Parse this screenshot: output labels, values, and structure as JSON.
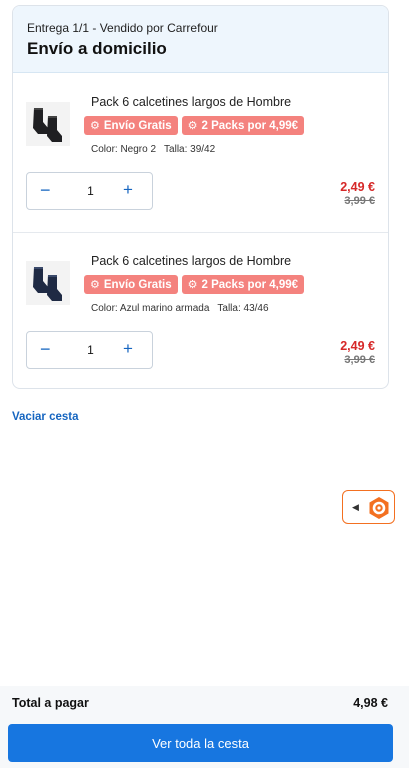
{
  "delivery": {
    "label": "Entrega 1/1 - Vendido por Carrefour",
    "title": "Envío a domicilio"
  },
  "items": [
    {
      "name": "Pack 6 calcetines largos de Hombre",
      "thumb_icon": "socks-image",
      "sock_color": "#1f1f22",
      "badges": [
        {
          "icon": "badge-icon",
          "label": "Envío Gratis"
        },
        {
          "icon": "badge-icon",
          "label": "2 Packs por 4,99€"
        }
      ],
      "color": "Color: Negro 2",
      "size": "Talla: 39/42",
      "quantity": "1",
      "price": "2,49 €",
      "old_price": "3,99 €"
    },
    {
      "name": "Pack 6 calcetines largos de Hombre",
      "thumb_icon": "socks-image",
      "sock_color": "#1f2a44",
      "badges": [
        {
          "icon": "badge-icon",
          "label": "Envío Gratis"
        },
        {
          "icon": "badge-icon",
          "label": "2 Packs por 4,99€"
        }
      ],
      "color": "Color: Azul marino armada",
      "size": "Talla: 43/46",
      "quantity": "1",
      "price": "2,49 €",
      "old_price": "3,99 €"
    }
  ],
  "controls": {
    "minus": "−",
    "plus": "+"
  },
  "empty_cart": "Vaciar cesta",
  "assistant": {
    "arrow": "◀",
    "icon": "assistant-logo-icon"
  },
  "footer": {
    "total_label": "Total a pagar",
    "total_value": "4,98 €",
    "cta": "Ver toda la cesta"
  },
  "colors": {
    "accent": "#1776e0",
    "badge": "#f4827e",
    "price": "#d62828",
    "assistant": "#f37021"
  }
}
